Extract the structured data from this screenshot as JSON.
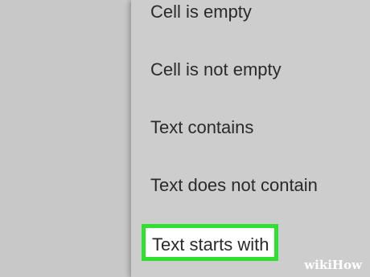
{
  "menu": {
    "items": [
      {
        "label": "Cell is empty"
      },
      {
        "label": "Cell is not empty"
      },
      {
        "label": "Text contains"
      },
      {
        "label": "Text does not contain"
      },
      {
        "label": "Text starts with",
        "highlighted": true
      }
    ],
    "highlight_color": "#2fe02f",
    "background_color": "#cdcdcd"
  },
  "watermark": {
    "text_part1": "wiki",
    "text_part2": "How"
  }
}
